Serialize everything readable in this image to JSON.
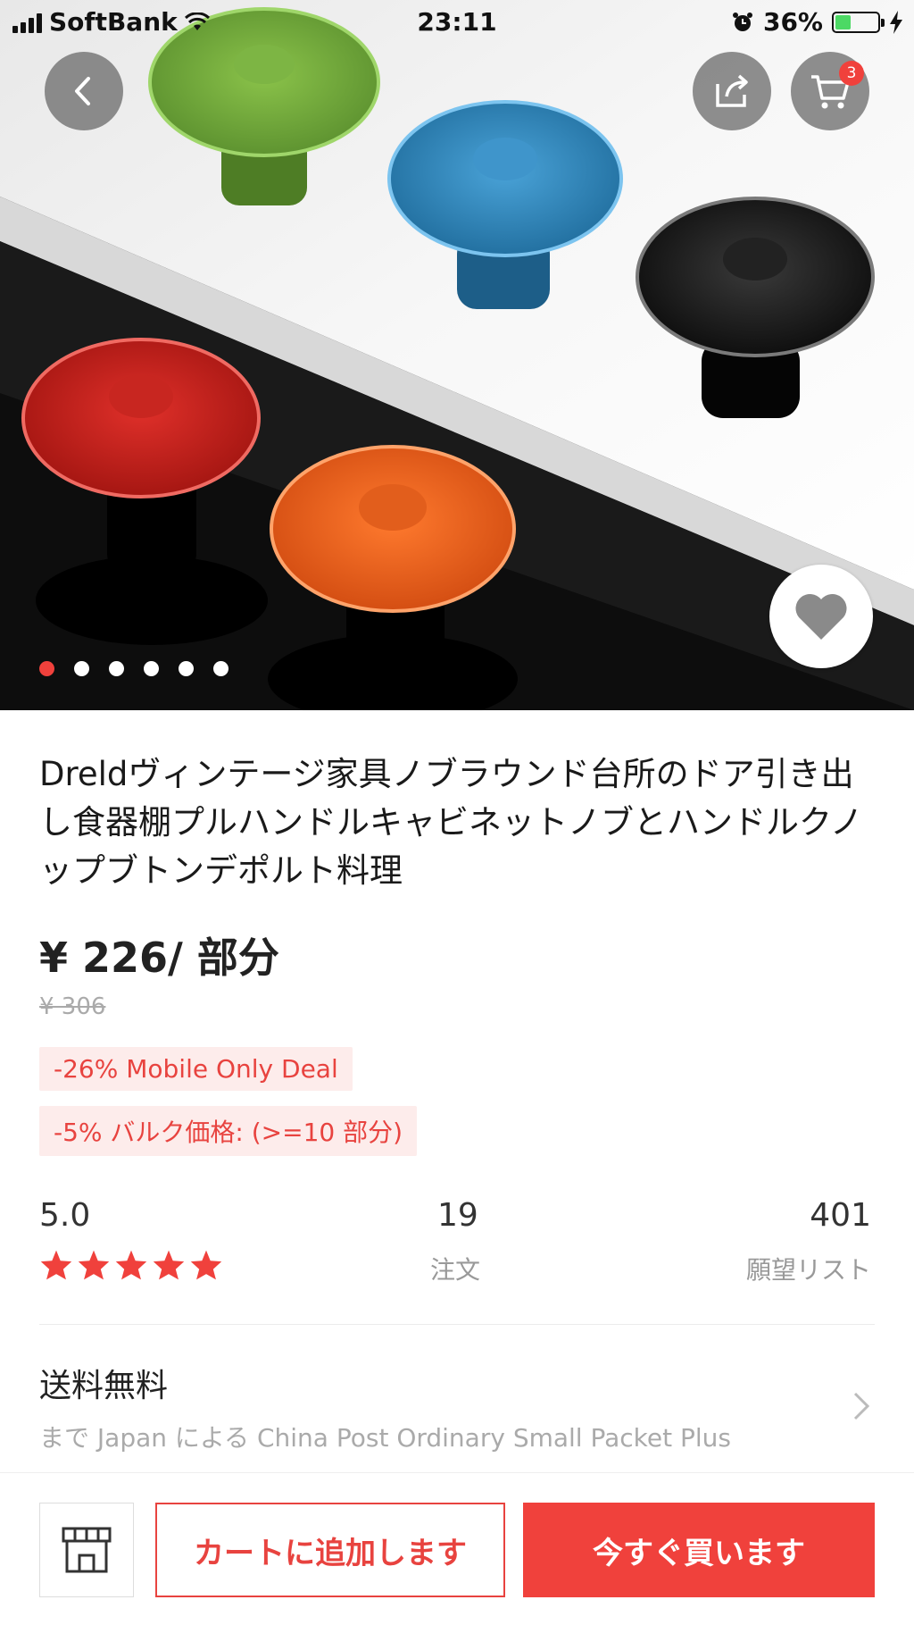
{
  "status_bar": {
    "carrier": "SoftBank",
    "time": "23:11",
    "battery_percent": "36%",
    "battery_level": 0.36
  },
  "header": {
    "cart_badge": "3",
    "icons": [
      "back-icon",
      "share-icon",
      "cart-icon",
      "heart-icon"
    ]
  },
  "gallery": {
    "image_count": 6,
    "active_index": 0
  },
  "product": {
    "title": "Dreldヴィンテージ家具ノブラウンド台所のドア引き出し食器棚プルハンドルキャビネットノブとハンドルクノップブトンデポルト料理",
    "price": "¥ 226/ 部分",
    "original_price": "¥ 306",
    "tags": [
      "-26% Mobile Only Deal",
      "-5% バルク価格: (>=10 部分)"
    ]
  },
  "stats": {
    "rating": "5.0",
    "stars": 5,
    "orders_count": "19",
    "orders_label": "注文",
    "wishlist_count": "401",
    "wishlist_label": "願望リスト"
  },
  "shipping": {
    "title": "送料無料",
    "detail": "まで Japan による China Post Ordinary Small Packet Plus"
  },
  "actions": {
    "add_to_cart": "カートに追加します",
    "buy_now": "今すぐ買います"
  },
  "colors": {
    "accent": "#f0413c",
    "tag_bg": "#fdeceb"
  }
}
